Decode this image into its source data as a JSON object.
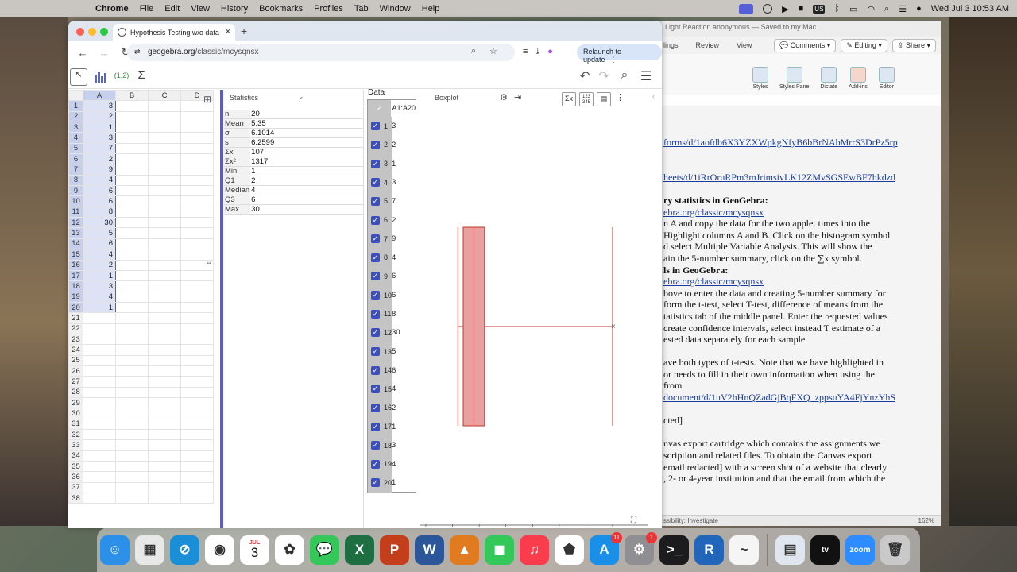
{
  "menubar": {
    "items": [
      "Chrome",
      "File",
      "Edit",
      "View",
      "History",
      "Bookmarks",
      "Profiles",
      "Tab",
      "Window",
      "Help"
    ],
    "input_source": "US",
    "clock": "Wed Jul 3  10:53 AM"
  },
  "word": {
    "title": "Light Reaction anonymous — Saved to my Mac",
    "tabs": [
      "lings",
      "Review",
      "View"
    ],
    "comments_label": "Comments",
    "editing_label": "Editing",
    "share_label": "Share",
    "ribbon_tools": [
      "Styles",
      "Styles Pane",
      "Dictate",
      "Add-ins",
      "Editor"
    ],
    "status_text": "ssibility: Investigate",
    "zoom": "162%",
    "lines": [
      {
        "text": "forms/d/1aofdb6X3YZXWpkgNfyB6bBrNAbMrrS3DrPz5rp",
        "link": true
      },
      {
        "text": "",
        "link": false
      },
      {
        "text": "",
        "link": false
      },
      {
        "text": "heets/d/1iRrOruRPm3mJrimsivLK12ZMvSGSEwBF7hkdzd",
        "link": true
      },
      {
        "text": "",
        "link": false
      },
      {
        "text": "ry statistics in GeoGebra:",
        "link": false,
        "bold": true
      },
      {
        "text": "ebra.org/classic/mcysqnsx",
        "link": true
      },
      {
        "text": "n A and copy the data for the two applet times into the",
        "link": false
      },
      {
        "text": "Highlight columns A and B. Click on the histogram symbol",
        "link": false
      },
      {
        "text": "d select Multiple Variable Analysis. This will show the",
        "link": false
      },
      {
        "text": "ain the 5-number summary, click on the ∑x symbol.",
        "link": false
      },
      {
        "text": "ls in GeoGebra:",
        "link": false,
        "bold": true
      },
      {
        "text": "ebra.org/classic/mcysqnsx",
        "link": true
      },
      {
        "text": "bove to enter the data and creating 5-number summary for",
        "link": false
      },
      {
        "text": "form the t-test, select T-test, difference of means from the",
        "link": false
      },
      {
        "text": "tatistics tab of the middle panel. Enter the requested values",
        "link": false
      },
      {
        "text": "create confidence intervals, select instead T estimate of a",
        "link": false
      },
      {
        "text": "ested data separately for each sample.",
        "link": false
      },
      {
        "text": "",
        "link": false
      },
      {
        "text": "ave both types of t-tests. Note that we have highlighted in",
        "link": false
      },
      {
        "text": "or needs to fill in their own information when using the",
        "link": false
      },
      {
        "text": "from",
        "link": false
      },
      {
        "text": "document/d/1uV2hHnQZadGjBqFXQ_zppsuYA4FjYnzYhS",
        "link": true
      },
      {
        "text": "",
        "link": false
      },
      {
        "text": "cted]",
        "link": false
      },
      {
        "text": "",
        "link": false
      },
      {
        "text": "nvas export cartridge which contains the assignments we",
        "link": false
      },
      {
        "text": "scription and related files. To obtain the Canvas export",
        "link": false
      },
      {
        "text": "email redacted] with a screen shot of a website that clearly",
        "link": false
      },
      {
        "text": ", 2- or 4-year institution and that the email from which the",
        "link": false
      }
    ]
  },
  "browser": {
    "tab_title": "Hypothesis Testing w/o data",
    "url_host": "geogebra.org",
    "url_path": "/classic/mcysqnsx",
    "relaunch_label": "Relaunch to update"
  },
  "geogebra": {
    "toolbar_label_point": "(1,2)",
    "sigma": "Σ",
    "sheet": {
      "columns": [
        "A",
        "B",
        "C",
        "D"
      ],
      "values": [
        3,
        2,
        1,
        3,
        7,
        2,
        9,
        4,
        6,
        6,
        8,
        30,
        5,
        6,
        4,
        2,
        1,
        3,
        4,
        1
      ],
      "row_count": 38
    },
    "stats": {
      "selector": "Statistics",
      "rows": [
        {
          "k": "n",
          "v": "20"
        },
        {
          "k": "Mean",
          "v": "5.35"
        },
        {
          "k": "σ",
          "v": "6.1014"
        },
        {
          "k": "s",
          "v": "6.2599"
        },
        {
          "k": "Σx",
          "v": "107"
        },
        {
          "k": "Σx²",
          "v": "1317"
        },
        {
          "k": "Min",
          "v": "1"
        },
        {
          "k": "Q1",
          "v": "2"
        },
        {
          "k": "Median",
          "v": "4"
        },
        {
          "k": "Q3",
          "v": "6"
        },
        {
          "k": "Max",
          "v": "30"
        }
      ]
    },
    "data_panel": {
      "title": "Data",
      "header": "A1:A20"
    },
    "graph": {
      "selector": "Boxplot",
      "sum_btn": "Σx",
      "grid_btn": "123\n345",
      "close": "×"
    }
  },
  "chart_data": {
    "type": "boxplot",
    "min": 1,
    "q1": 2,
    "median": 4,
    "q3": 6,
    "max": 30,
    "xlim": [
      -5,
      30
    ],
    "xticks": [
      -5,
      0,
      5,
      10,
      15,
      20,
      25,
      30
    ],
    "color": "#e8a0a0",
    "stroke": "#c0392b"
  },
  "dock": {
    "apps": [
      "Finder",
      "Launchpad",
      "Safari",
      "Chrome",
      "Calendar",
      "Photos",
      "Messages",
      "Excel",
      "PowerPoint",
      "Word",
      "MATLAB",
      "FaceTime",
      "Music",
      "GeoGebra",
      "App Store",
      "System Settings",
      "Terminal",
      "R",
      "Freeform",
      "Preview",
      "Apple TV",
      "Zoom",
      "Trash"
    ],
    "calendar_month": "JUL",
    "calendar_day": "3",
    "appstore_badge": "11",
    "settings_badge": "1"
  }
}
